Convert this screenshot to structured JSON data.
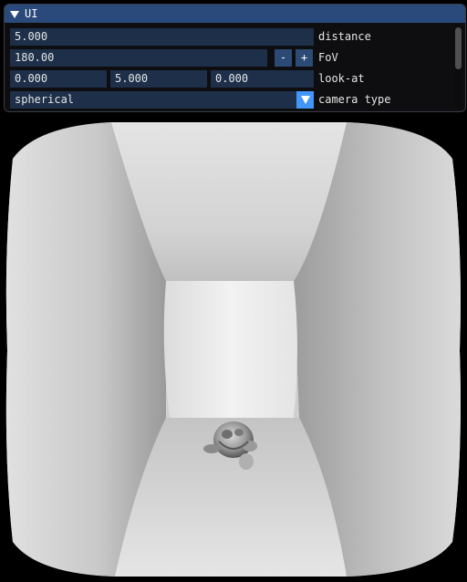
{
  "window": {
    "title": "UI"
  },
  "distance": {
    "value": "5.000",
    "label": "distance"
  },
  "fov": {
    "value": "180.00",
    "minus": "-",
    "plus": "+",
    "label": "FoV"
  },
  "look_at": {
    "x": "0.000",
    "y": "5.000",
    "z": "0.000",
    "label": "look-at"
  },
  "camera_type": {
    "selected": "spherical",
    "label": "camera type"
  },
  "colors": {
    "title_bar": "#294a7a",
    "field_bg": "#1d2f49",
    "button_bg": "#2b4a74",
    "combo_arrow_bg": "#4296fa"
  },
  "viewport": {
    "description_icon": "rendered-3d-scene"
  }
}
